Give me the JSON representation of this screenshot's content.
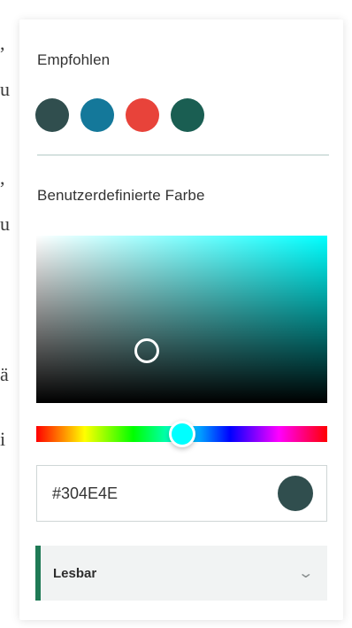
{
  "background_fragments": [
    ",",
    "u",
    ",",
    "u",
    "ä",
    "i"
  ],
  "recommended": {
    "title": "Empfohlen",
    "swatches": [
      "#304E4E",
      "#14789A",
      "#E8433A",
      "#1A5E52"
    ]
  },
  "custom": {
    "title": "Benutzerdefinierte Farbe",
    "hue_color": "#00FFFF",
    "hue_percent": 50,
    "saturation_percent": 38,
    "value_percent": 31
  },
  "hex": {
    "value": "#304E4E",
    "preview_color": "#304E4E"
  },
  "readability": {
    "label": "Lesbar",
    "accent_color": "#1F7A55",
    "chevron_icon": "chevron-down-icon"
  }
}
